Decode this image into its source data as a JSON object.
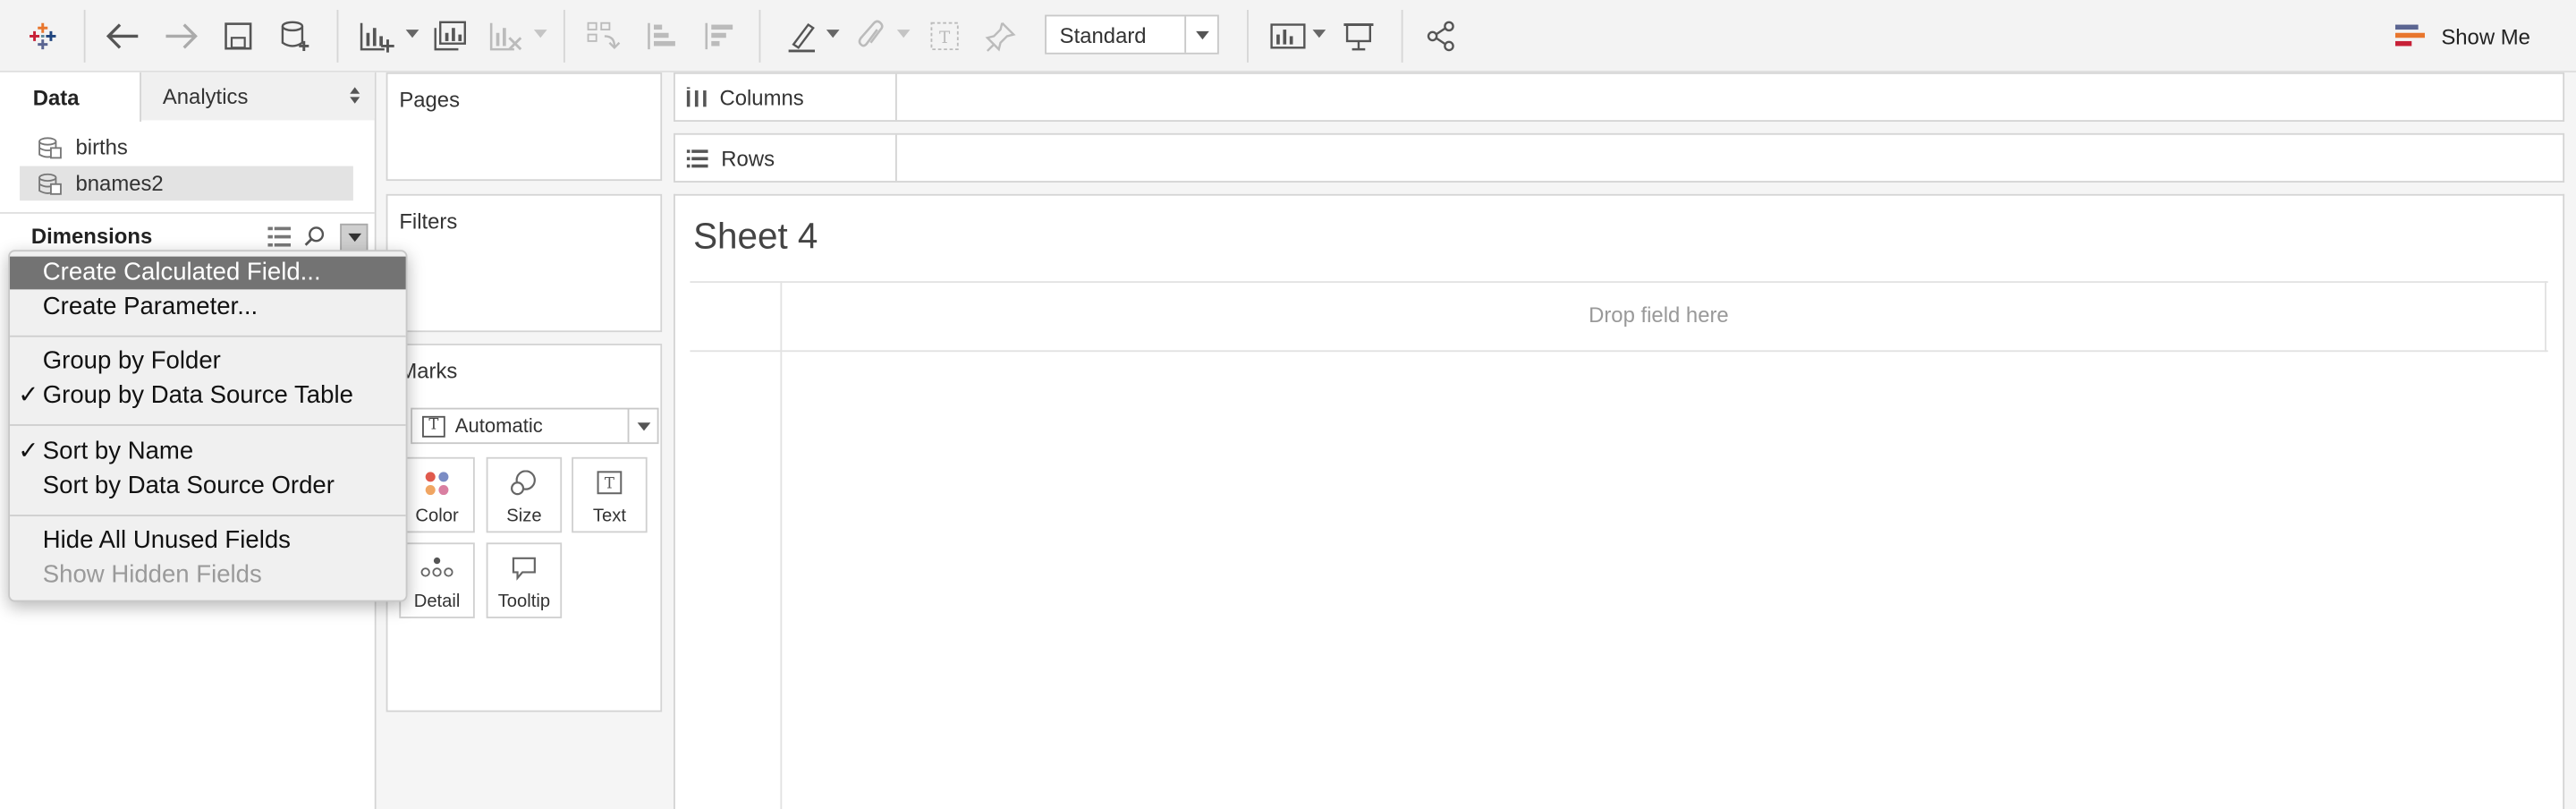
{
  "toolbar": {
    "view_size": "Standard",
    "show_me": "Show Me"
  },
  "data_pane": {
    "tabs": [
      "Data",
      "Analytics"
    ],
    "data_sources": [
      "births",
      "bnames2"
    ],
    "dimensions_label": "Dimensions"
  },
  "cards": {
    "pages": "Pages",
    "filters": "Filters",
    "marks": "Marks",
    "mark_type": "Automatic",
    "mark_buttons": [
      "Color",
      "Size",
      "Text",
      "Detail",
      "Tooltip"
    ]
  },
  "shelves": {
    "columns": "Columns",
    "rows": "Rows"
  },
  "view": {
    "sheet_title": "Sheet 4",
    "drop_hint": "Drop field here"
  },
  "context_menu": {
    "items": [
      {
        "label": "Create Calculated Field...",
        "highlighted": true,
        "checked": false,
        "disabled": false
      },
      {
        "label": "Create Parameter...",
        "highlighted": false,
        "checked": false,
        "disabled": false
      },
      {
        "label": "Group by Folder",
        "highlighted": false,
        "checked": false,
        "disabled": false
      },
      {
        "label": "Group by Data Source Table",
        "highlighted": false,
        "checked": true,
        "disabled": false
      },
      {
        "label": "Sort by Name",
        "highlighted": false,
        "checked": true,
        "disabled": false
      },
      {
        "label": "Sort by Data Source Order",
        "highlighted": false,
        "checked": false,
        "disabled": false
      },
      {
        "label": "Hide All Unused Fields",
        "highlighted": false,
        "checked": false,
        "disabled": false
      },
      {
        "label": "Show Hidden Fields",
        "highlighted": false,
        "checked": false,
        "disabled": true
      }
    ],
    "check_mark": "✓"
  }
}
